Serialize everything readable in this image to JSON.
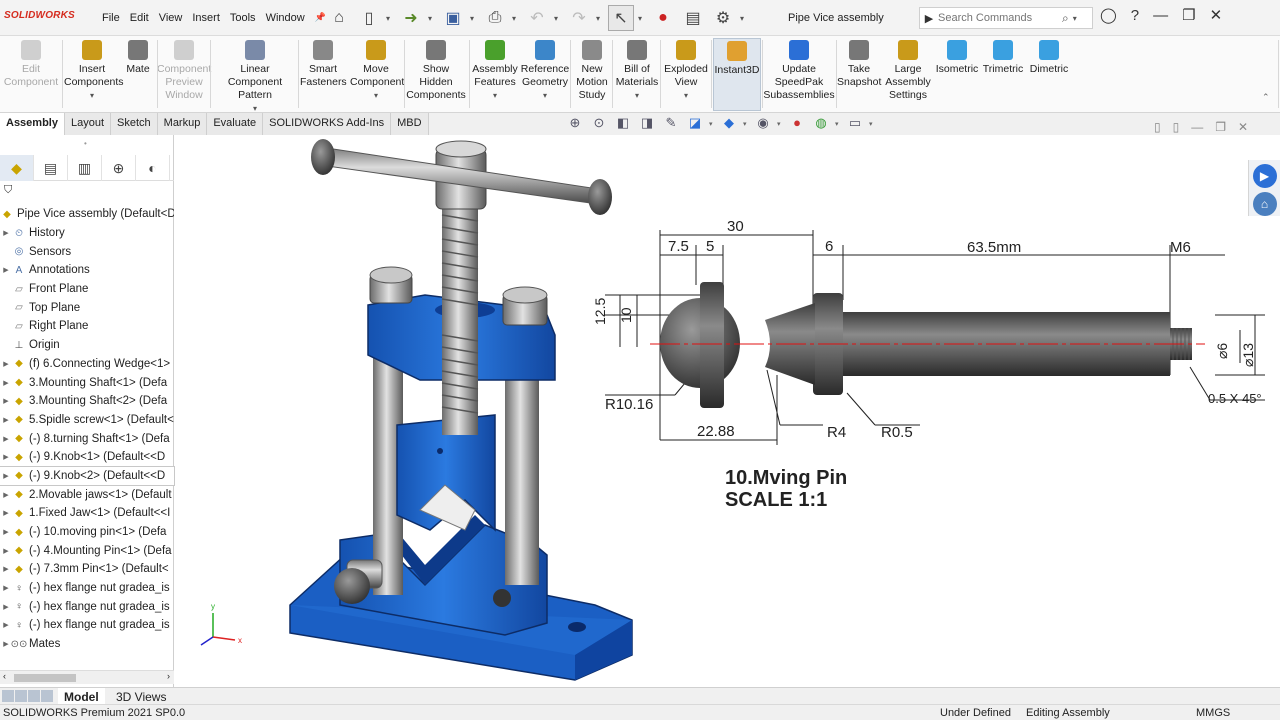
{
  "app": {
    "logo": "SOLIDWORKS",
    "menu": [
      "File",
      "Edit",
      "View",
      "Insert",
      "Tools",
      "Window"
    ],
    "document_title": "Pipe Vice assembly",
    "search_placeholder": "Search Commands"
  },
  "ribbon": [
    {
      "label": "Edit\nComponent",
      "disabled": true,
      "icon": "edit-component-icon"
    },
    {
      "label": "Insert\nComponents",
      "icon": "insert-components-icon",
      "dropdown": true
    },
    {
      "label": "Mate",
      "icon": "mate-icon"
    },
    {
      "label": "Component\nPreview\nWindow",
      "disabled": true,
      "icon": "component-preview-icon"
    },
    {
      "label": "Linear Component\nPattern",
      "icon": "linear-pattern-icon",
      "dropdown": true
    },
    {
      "label": "Smart\nFasteners",
      "icon": "smart-fasteners-icon"
    },
    {
      "label": "Move\nComponent",
      "icon": "move-component-icon",
      "dropdown": true
    },
    {
      "label": "Show\nHidden\nComponents",
      "icon": "show-hidden-icon"
    },
    {
      "label": "Assembly\nFeatures",
      "icon": "assembly-features-icon",
      "dropdown": true
    },
    {
      "label": "Reference\nGeometry",
      "icon": "reference-geometry-icon",
      "dropdown": true
    },
    {
      "label": "New\nMotion\nStudy",
      "icon": "motion-study-icon"
    },
    {
      "label": "Bill of\nMaterials",
      "icon": "bom-icon",
      "dropdown": true
    },
    {
      "label": "Exploded\nView",
      "icon": "exploded-view-icon",
      "dropdown": true
    },
    {
      "label": "Instant3D",
      "icon": "instant3d-icon",
      "active": true
    },
    {
      "label": "Update\nSpeedPak\nSubassemblies",
      "icon": "speedpak-icon"
    },
    {
      "label": "Take\nSnapshot",
      "icon": "snapshot-icon"
    },
    {
      "label": "Large\nAssembly\nSettings",
      "icon": "large-assembly-icon"
    },
    {
      "label": "Isometric",
      "icon": "isometric-icon"
    },
    {
      "label": "Trimetric",
      "icon": "trimetric-icon"
    },
    {
      "label": "Dimetric",
      "icon": "dimetric-icon"
    }
  ],
  "tabs": [
    "Assembly",
    "Layout",
    "Sketch",
    "Markup",
    "Evaluate",
    "SOLIDWORKS Add-Ins",
    "MBD"
  ],
  "tree": {
    "root": "Pipe Vice assembly  (Default<D",
    "items": [
      {
        "label": "History",
        "icon": "history-icon",
        "arrow": true
      },
      {
        "label": "Sensors",
        "icon": "sensors-icon"
      },
      {
        "label": "Annotations",
        "icon": "annotations-icon",
        "arrow": true
      },
      {
        "label": "Front Plane",
        "icon": "plane-icon"
      },
      {
        "label": "Top Plane",
        "icon": "plane-icon"
      },
      {
        "label": "Right Plane",
        "icon": "plane-icon"
      },
      {
        "label": "Origin",
        "icon": "origin-icon"
      },
      {
        "label": "(f) 6.Connecting Wedge<1>",
        "icon": "part-icon",
        "arrow": true
      },
      {
        "label": "3.Mounting Shaft<1> (Defa",
        "icon": "part-icon",
        "arrow": true
      },
      {
        "label": "3.Mounting Shaft<2> (Defa",
        "icon": "part-icon",
        "arrow": true
      },
      {
        "label": "5.Spidle screw<1> (Default<",
        "icon": "part-icon",
        "arrow": true
      },
      {
        "label": "(-) 8.turning Shaft<1> (Defa",
        "icon": "part-icon",
        "arrow": true
      },
      {
        "label": "(-) 9.Knob<1> (Default<<D",
        "icon": "part-icon",
        "arrow": true
      },
      {
        "label": "(-) 9.Knob<2> (Default<<D",
        "icon": "part-icon",
        "arrow": true,
        "selected": true
      },
      {
        "label": "2.Movable jaws<1> (Default",
        "icon": "part-icon",
        "arrow": true
      },
      {
        "label": "1.Fixed Jaw<1> (Default<<I",
        "icon": "part-icon",
        "arrow": true
      },
      {
        "label": "(-) 10.moving pin<1> (Defa",
        "icon": "part-icon",
        "arrow": true
      },
      {
        "label": "(-) 4.Mounting Pin<1> (Defa",
        "icon": "part-icon",
        "arrow": true
      },
      {
        "label": "(-) 7.3mm Pin<1> (Default<",
        "icon": "part-icon",
        "arrow": true
      },
      {
        "label": "(-) hex flange nut gradea_is",
        "icon": "nut-icon",
        "arrow": true
      },
      {
        "label": "(-) hex flange nut gradea_is",
        "icon": "nut-icon",
        "arrow": true
      },
      {
        "label": "(-) hex flange nut gradea_is",
        "icon": "nut-icon",
        "arrow": true
      },
      {
        "label": "Mates",
        "icon": "mates-icon",
        "arrow": true
      }
    ]
  },
  "bottom_tabs": [
    "Model",
    "3D Views"
  ],
  "status": {
    "product": "SOLIDWORKS Premium 2021 SP0.0",
    "state": "Under Defined",
    "mode": "Editing Assembly",
    "units": "MMGS"
  },
  "drawing": {
    "dims": [
      "30",
      "7.5",
      "5",
      "6",
      "63.5mm",
      "M6",
      "12.5",
      "10",
      "⌀6",
      "⌀13",
      "R10.16",
      "22.88",
      "R4",
      "R0.5",
      "0.5 X 45°"
    ],
    "title": "10.Mving Pin",
    "scale": "SCALE 1:1"
  },
  "colors": {
    "accent": "#2b6fd6",
    "part_blue": "#1f6fd0",
    "logo_red": "#d52b1e"
  }
}
